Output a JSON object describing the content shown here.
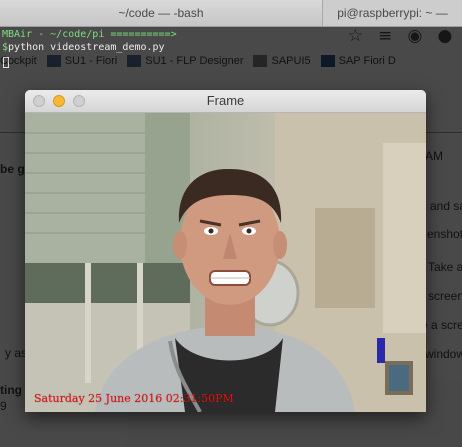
{
  "terminal": {
    "tabs": [
      {
        "label": "~/code — -bash"
      },
      {
        "label": "pi@raspberrypi: ~ —"
      }
    ],
    "prompt_line": "MBAir - ~/code/pi ==========>",
    "command_bracket": "$",
    "command": "python videostream_demo.py"
  },
  "browser_background": {
    "bookmarks": [
      {
        "label": "Cockpit"
      },
      {
        "label": "SU1 - Fiori"
      },
      {
        "label": "SU1 - FLP Designer"
      },
      {
        "label": "SAPUI5"
      },
      {
        "label": "SAP Fiori D"
      }
    ],
    "snippets": [
      {
        "text": "be g"
      },
      {
        "text": "AM"
      },
      {
        "text": "and sa"
      },
      {
        "text": "enshot"
      },
      {
        "text": "Take a"
      },
      {
        "text": "screen"
      },
      {
        "text": "e a scre"
      },
      {
        "text": "window"
      },
      {
        "text": "y as"
      },
      {
        "text": "ting"
      },
      {
        "text": "9"
      }
    ]
  },
  "frame_window": {
    "title": "Frame",
    "overlay_text": "Saturday 25 June 2016 02:31:50PM"
  },
  "colors": {
    "prompt_green": "#55d855",
    "overlay_red": "#e80f0f",
    "minimize_yellow": "#f6b935"
  }
}
